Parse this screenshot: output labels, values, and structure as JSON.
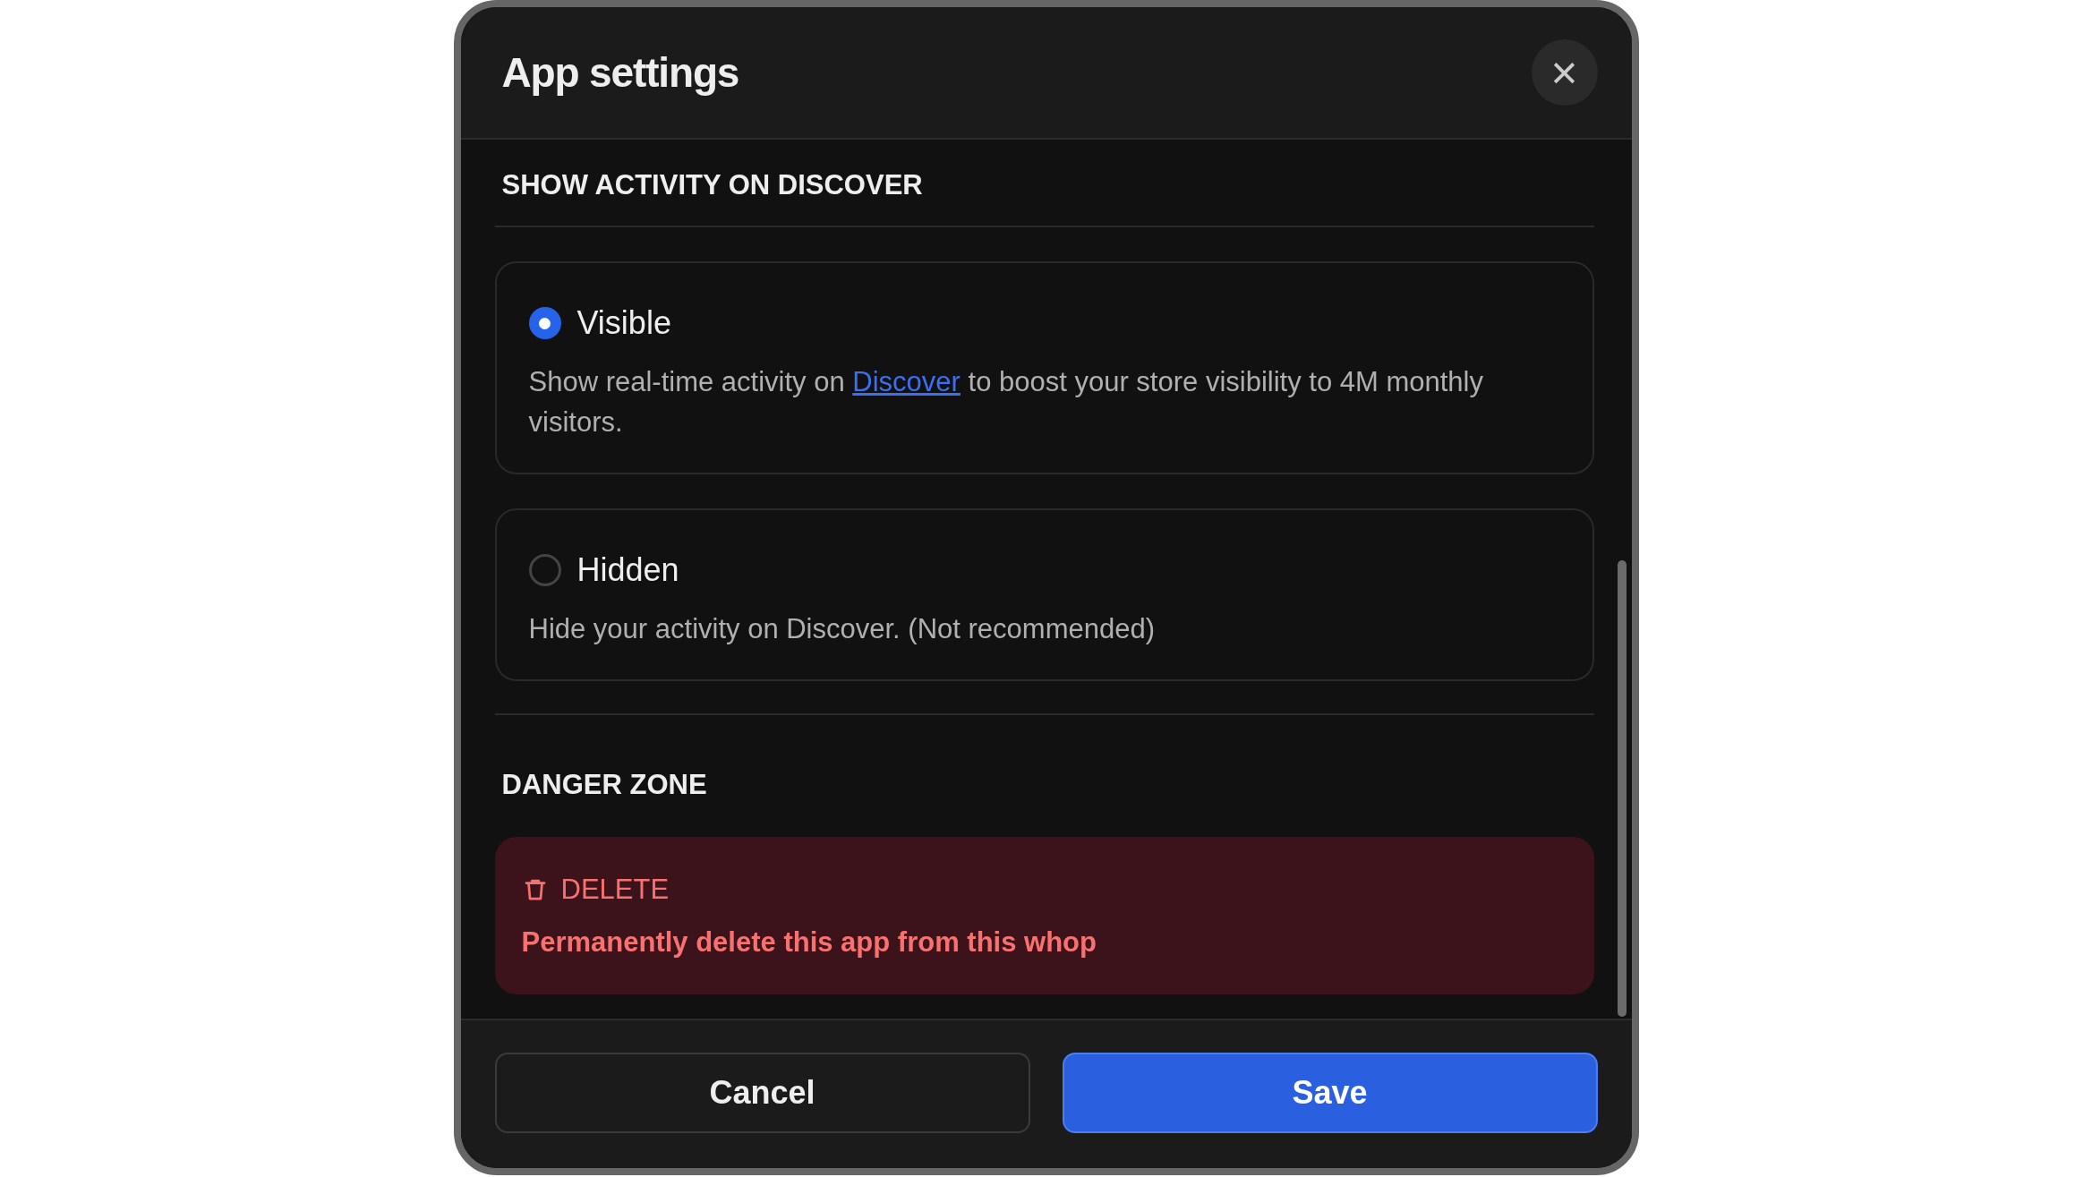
{
  "dialog": {
    "title": "App settings",
    "close_icon": "×"
  },
  "activity_section": {
    "heading": "SHOW ACTIVITY ON DISCOVER",
    "options": [
      {
        "label": "Visible",
        "selected": true,
        "description_before": "Show real-time activity on ",
        "link": "Discover",
        "description_after": " to boost your store visibility to 4M monthly visitors."
      },
      {
        "label": "Hidden",
        "selected": false,
        "description_before": "Hide your activity on Discover. (Not recommended)"
      }
    ]
  },
  "danger_section": {
    "heading": "DANGER ZONE",
    "action": {
      "label": "DELETE",
      "description": "Permanently delete this app from this whop"
    }
  },
  "footer": {
    "buttons": [
      {
        "label": "Cancel",
        "kind": "secondary"
      },
      {
        "label": "Save",
        "kind": "primary"
      }
    ]
  }
}
